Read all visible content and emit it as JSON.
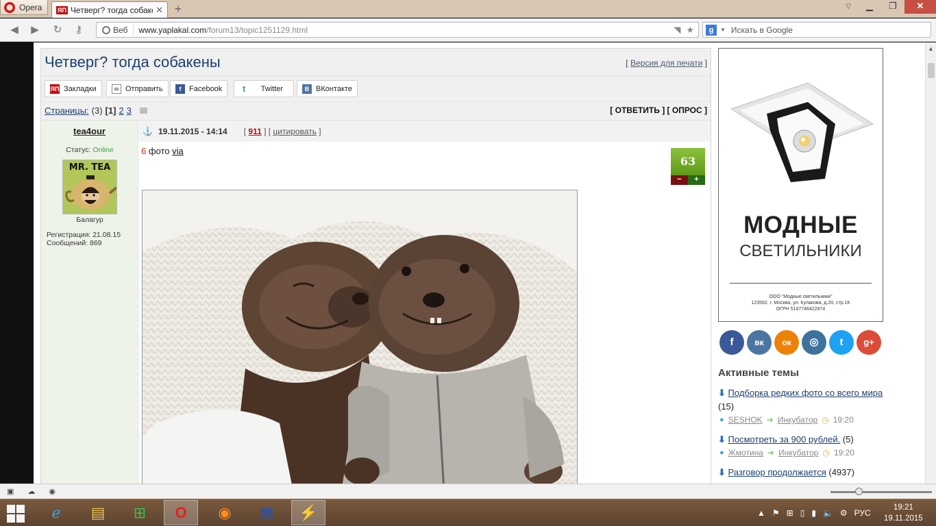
{
  "browser": {
    "menu_label": "Opera",
    "tab_title": "Четверг? тогда собаке...",
    "tab_favicon": "ЯП",
    "address_badge": "Веб",
    "url_host": "www.yaplakal.com",
    "url_path": "/forum13/topic1251129.html",
    "search_placeholder": "Искать в Google"
  },
  "topic": {
    "title": "Четверг? тогда собакены",
    "print_link": "Версия для печати"
  },
  "share": [
    {
      "label": "Закладки",
      "icon": "yap-bookmark-icon"
    },
    {
      "label": "Отправить",
      "icon": "mail-icon"
    },
    {
      "label": "Facebook",
      "icon": "facebook-icon"
    },
    {
      "label": "Twitter",
      "icon": "twitter-icon"
    },
    {
      "label": "ВКонтакте",
      "icon": "vk-icon"
    }
  ],
  "pages": {
    "label": "Страницы:",
    "count": "(3)",
    "current": "[1]",
    "p2": "2",
    "p3": "3",
    "actions": "[ ОТВЕТИТЬ ] [ ОПРОС ]"
  },
  "post": {
    "author": "tea4our",
    "date": "19.11.2015 - 14:14",
    "number": "911",
    "quote": "цитировать",
    "status_label": "Статус:",
    "status": "Online",
    "avatar_text": "MR. TEA",
    "rank": "Балагур",
    "registration": "Регистрация: 21.08.15",
    "messages": "Сообщений: 869",
    "photo_count": "6",
    "photo_word": "фото",
    "via": "via",
    "rating": "63",
    "minus": "−",
    "plus": "+"
  },
  "ad": {
    "title": "МОДНЫЕ",
    "subtitle": "СВЕТИЛЬНИКИ",
    "company": "ООО \"Модные светильники\"",
    "address": "123592, г. Москва, ул. Кулакова, д.20, стр.1К",
    "ogrn": "ОГРН 5147746422874"
  },
  "social": [
    {
      "letter": "f",
      "color": "#3b5998",
      "icon": "facebook-icon"
    },
    {
      "letter": "вк",
      "color": "#4c75a3",
      "icon": "vk-icon"
    },
    {
      "letter": "ок",
      "color": "#ee8208",
      "icon": "odnoklassniki-icon"
    },
    {
      "letter": "◎",
      "color": "#3f729b",
      "icon": "instagram-icon"
    },
    {
      "letter": "t",
      "color": "#1da1f2",
      "icon": "twitter-icon"
    },
    {
      "letter": "g+",
      "color": "#dd4b39",
      "icon": "google-plus-icon"
    }
  ],
  "active": {
    "title": "Активные темы",
    "topics": [
      {
        "title": "Подборка редких фото со всего мира",
        "count": "(15)",
        "user": "SESHOK",
        "section": "Инкубатор",
        "time": "19:20"
      },
      {
        "title": "Посмотреть за 900 рублей.",
        "count": "(5)",
        "user": "Жмотина",
        "section": "Инкубатор",
        "time": "19:20"
      },
      {
        "title": "Разговор продолжается",
        "count": "(4937)"
      }
    ]
  },
  "taskbar": {
    "lang": "РУС",
    "time": "19:21",
    "date": "19.11.2015"
  }
}
